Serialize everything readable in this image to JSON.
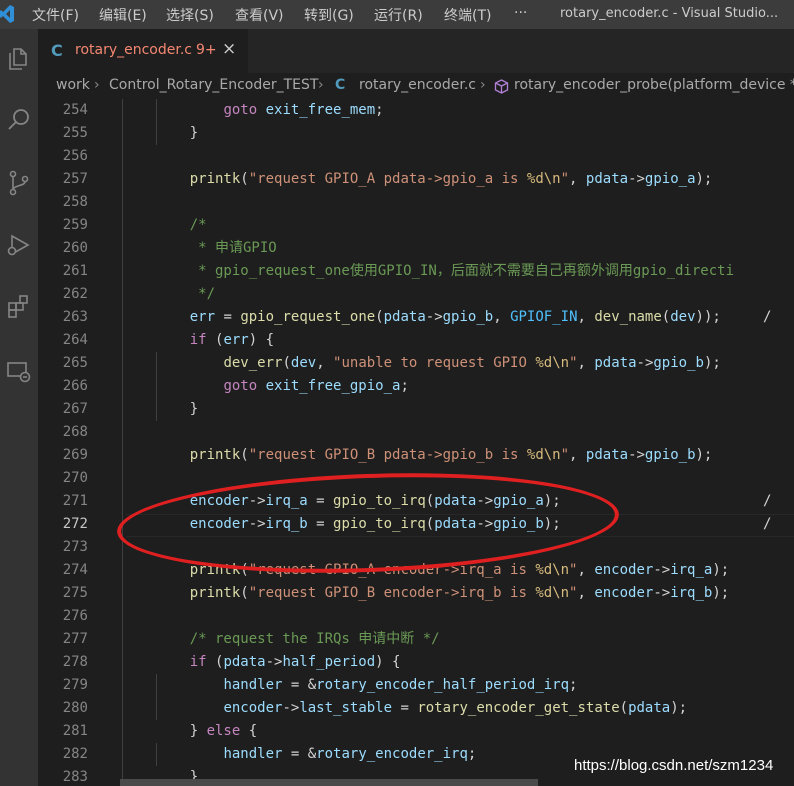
{
  "menu": {
    "items": [
      "文件(F)",
      "编辑(E)",
      "选择(S)",
      "查看(V)",
      "转到(G)",
      "运行(R)",
      "终端(T)",
      "···"
    ],
    "window_title": "rotary_encoder.c - Visual Studio..."
  },
  "activity_bar": {
    "icons": [
      "explorer-icon",
      "search-icon",
      "source-control-icon",
      "run-debug-icon",
      "extensions-icon",
      "remote-explorer-icon"
    ]
  },
  "tab": {
    "lang_badge": "C",
    "name": "rotary_encoder.c",
    "problem_count": "9+",
    "close": "×"
  },
  "breadcrumb": {
    "items": [
      "work",
      "Control_Rotary_Encoder_TEST",
      "rotary_encoder.c",
      "rotary_encoder_probe(platform_device *)"
    ],
    "separator": "›",
    "c_badge": "C"
  },
  "editor": {
    "current_line": 272,
    "lines": [
      {
        "n": "254",
        "code": "        goto exit_free_mem;"
      },
      {
        "n": "255",
        "code": "    }"
      },
      {
        "n": "256",
        "code": ""
      },
      {
        "n": "257",
        "code": "    printk(\"request GPIO_A pdata->gpio_a is %d\\n\", pdata->gpio_a);"
      },
      {
        "n": "258",
        "code": ""
      },
      {
        "n": "259",
        "code": "    /*"
      },
      {
        "n": "260",
        "code": "     * 申请GPIO"
      },
      {
        "n": "261",
        "code": "     * gpio_request_one使用GPIO_IN，后面就不需要自己再额外调用gpio_directi"
      },
      {
        "n": "262",
        "code": "     */"
      },
      {
        "n": "263",
        "code": "    err = gpio_request_one(pdata->gpio_b, GPIOF_IN, dev_name(dev));     /"
      },
      {
        "n": "264",
        "code": "    if (err) {"
      },
      {
        "n": "265",
        "code": "        dev_err(dev, \"unable to request GPIO %d\\n\", pdata->gpio_b);"
      },
      {
        "n": "266",
        "code": "        goto exit_free_gpio_a;"
      },
      {
        "n": "267",
        "code": "    }"
      },
      {
        "n": "268",
        "code": ""
      },
      {
        "n": "269",
        "code": "    printk(\"request GPIO_B pdata->gpio_b is %d\\n\", pdata->gpio_b);"
      },
      {
        "n": "270",
        "code": ""
      },
      {
        "n": "271",
        "code": "    encoder->irq_a = gpio_to_irq(pdata->gpio_a);                        /"
      },
      {
        "n": "272",
        "code": "    encoder->irq_b = gpio_to_irq(pdata->gpio_b);                        /"
      },
      {
        "n": "273",
        "code": ""
      },
      {
        "n": "274",
        "code": "    printk(\"request GPIO_A encoder->irq_a is %d\\n\", encoder->irq_a);"
      },
      {
        "n": "275",
        "code": "    printk(\"request GPIO_B encoder->irq_b is %d\\n\", encoder->irq_b);"
      },
      {
        "n": "276",
        "code": ""
      },
      {
        "n": "277",
        "code": "    /* request the IRQs 申请中断 */"
      },
      {
        "n": "278",
        "code": "    if (pdata->half_period) {"
      },
      {
        "n": "279",
        "code": "        handler = &rotary_encoder_half_period_irq;"
      },
      {
        "n": "280",
        "code": "        encoder->last_stable = rotary_encoder_get_state(pdata);"
      },
      {
        "n": "281",
        "code": "    } else {"
      },
      {
        "n": "282",
        "code": "        handler = &rotary_encoder_irq;"
      },
      {
        "n": "283",
        "code": "    }"
      }
    ]
  },
  "watermark": "https://blog.csdn.net/szm1234",
  "colors": {
    "annotation": "#e02020",
    "keyword": "#c586c0",
    "function": "#dcdcaa",
    "variable": "#9cdcfe",
    "string": "#ce9178",
    "comment": "#6a9955"
  }
}
